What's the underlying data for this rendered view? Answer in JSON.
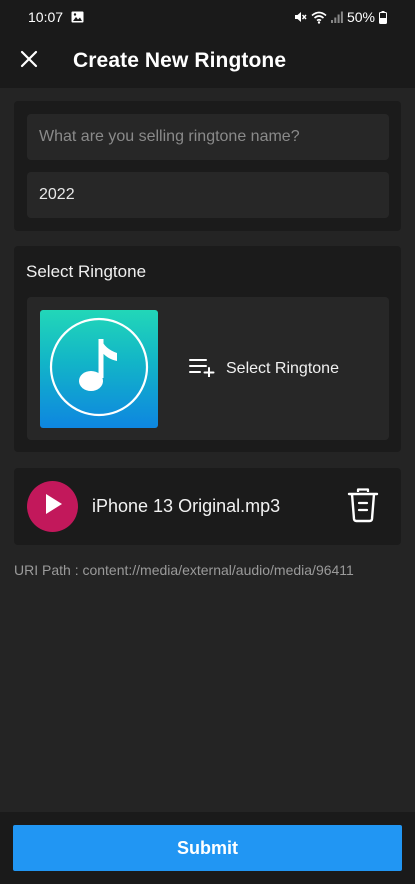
{
  "status_bar": {
    "time": "10:07",
    "battery": "50%",
    "icons": [
      "image-icon",
      "mute-icon",
      "wifi-icon",
      "signal-icon",
      "battery-icon"
    ]
  },
  "app_bar": {
    "close_icon": "close-icon",
    "title": "Create New Ringtone"
  },
  "form": {
    "name_placeholder": "What are you selling ringtone name?",
    "name_value": "",
    "year_value": "2022"
  },
  "select_section": {
    "title": "Select Ringtone",
    "thumbnail_icon": "music-note-icon",
    "action_icon": "playlist-add-icon",
    "action_label": "Select Ringtone"
  },
  "file": {
    "play_icon": "play-icon",
    "name": "iPhone 13 Original.mp3",
    "delete_icon": "trash-icon"
  },
  "uri_path": "URI Path : content://media/external/audio/media/96411",
  "submit_label": "Submit",
  "colors": {
    "background": "#242424",
    "card": "#1b1b1b",
    "field": "#272727",
    "accent": "#2196f3",
    "play": "#c2185b"
  }
}
